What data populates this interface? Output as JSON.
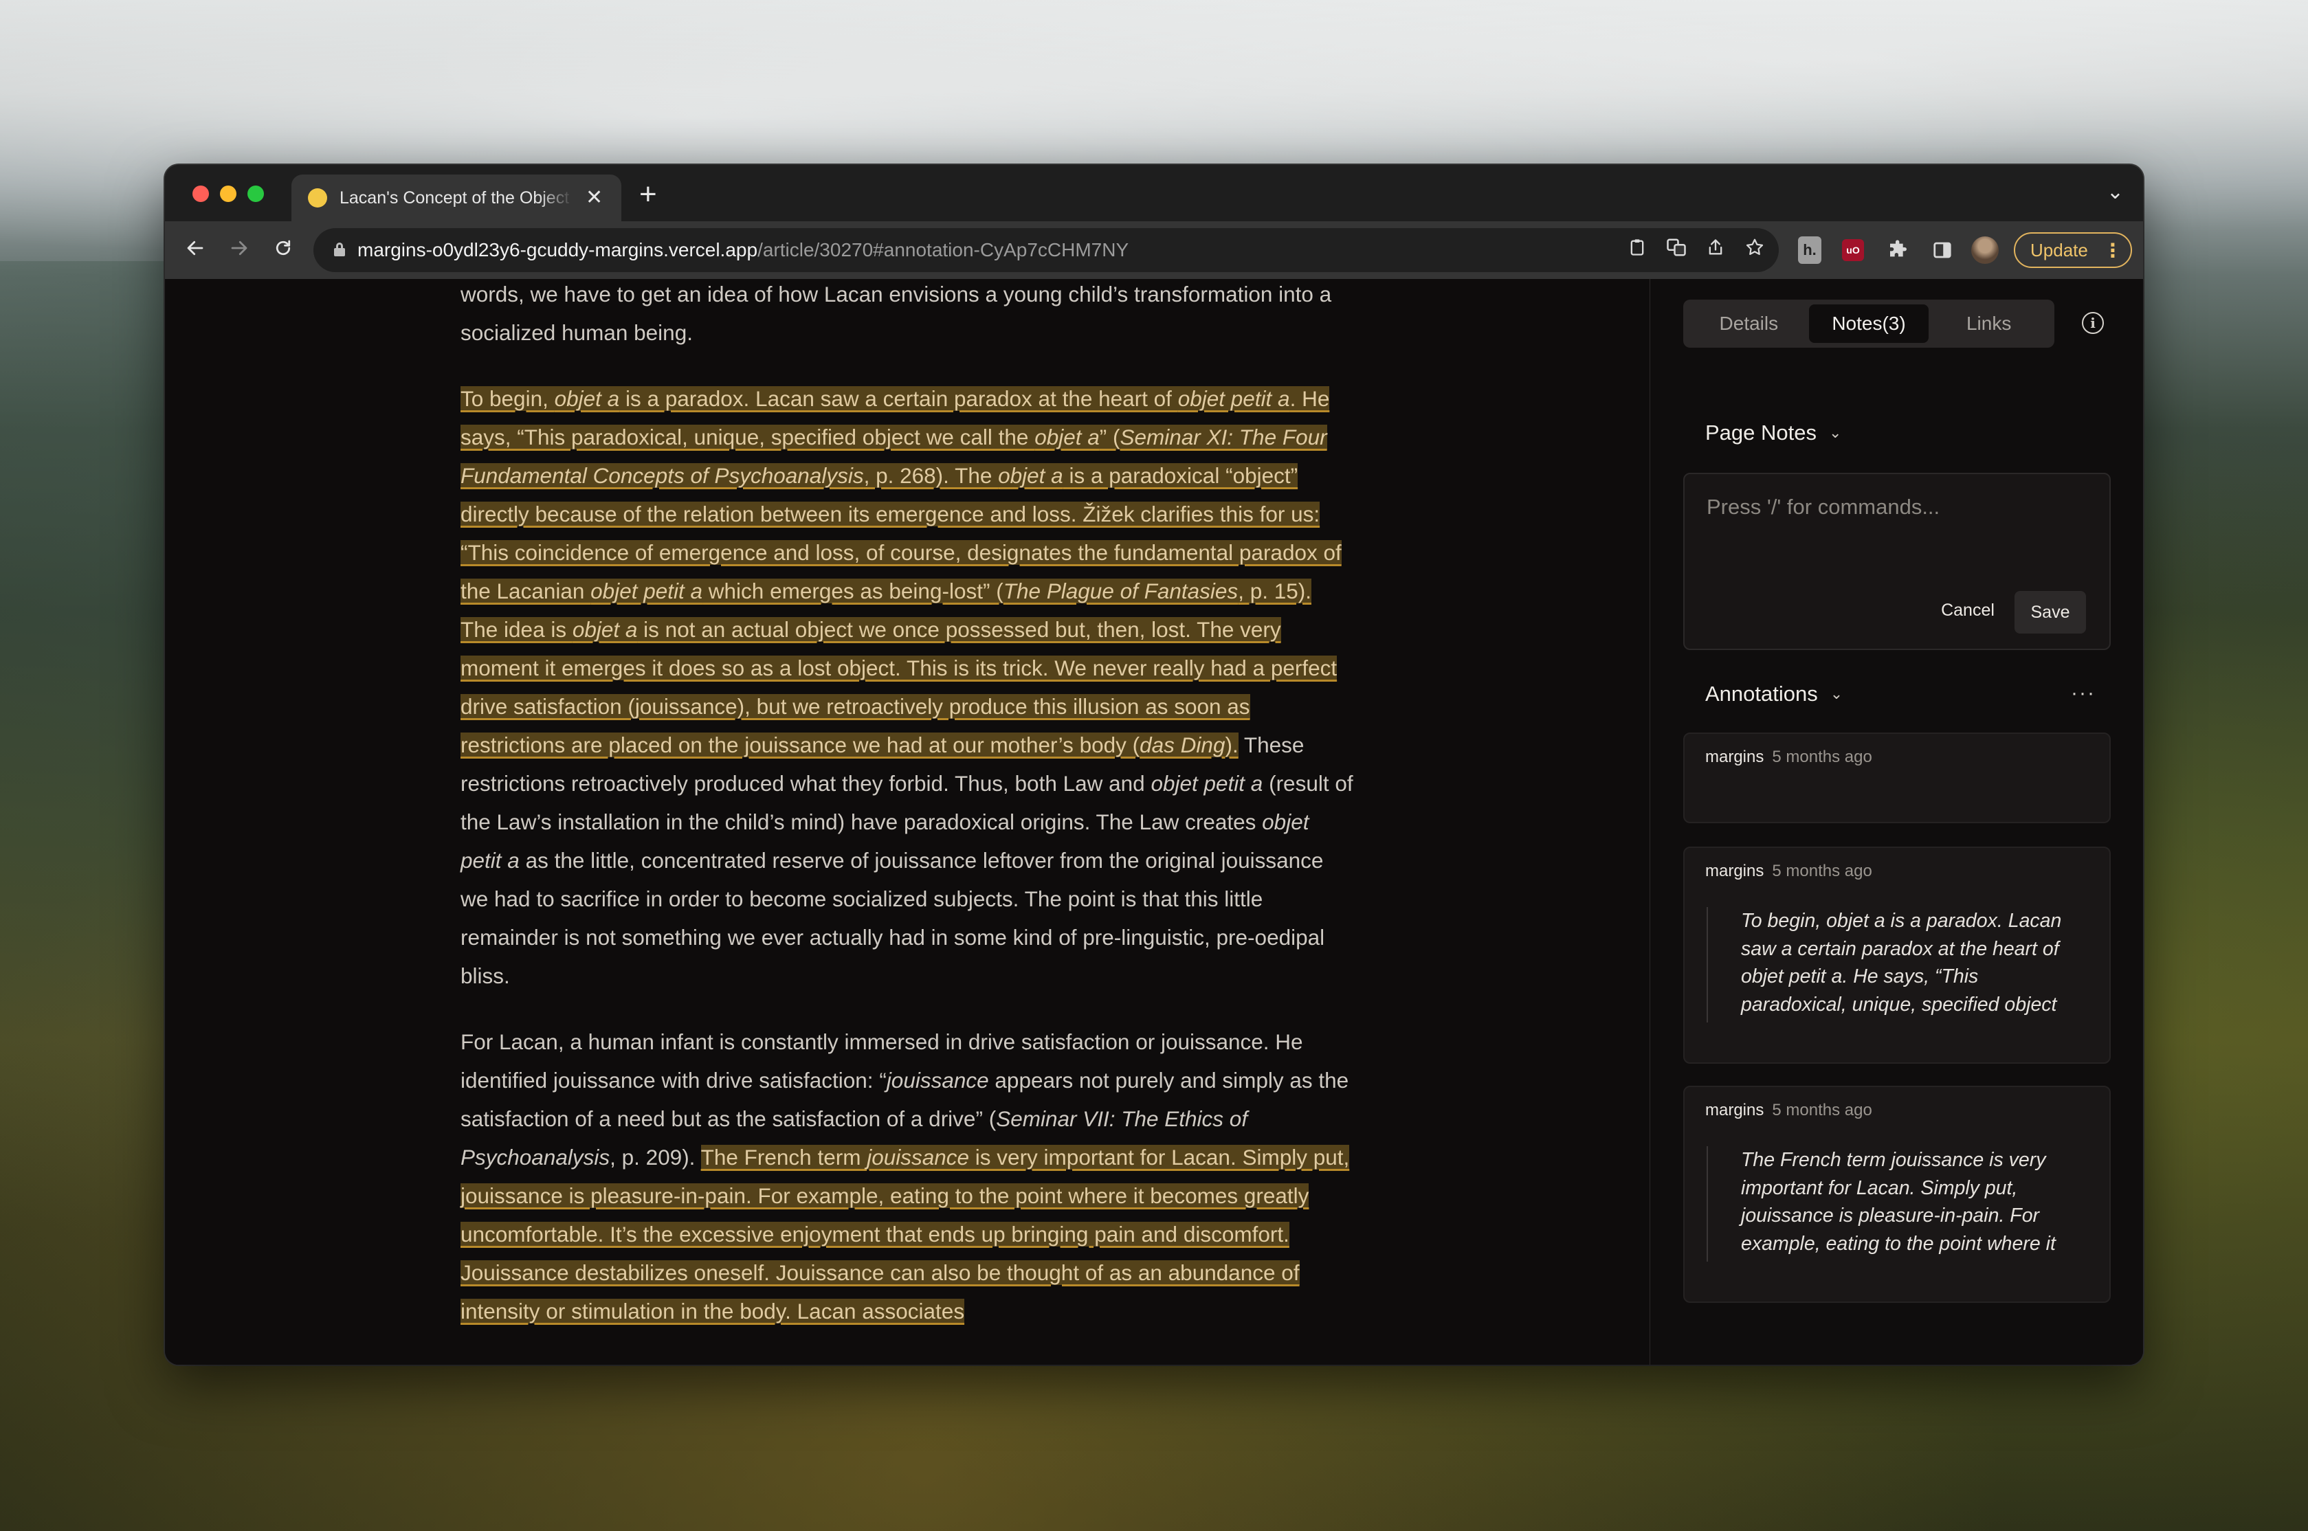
{
  "browser": {
    "tab": {
      "title": "Lacan's Concept of the Object petit a",
      "close": "✕"
    },
    "new_tab": "+",
    "tab_menu": "⌄",
    "url_host": "margins-o0ydl23y6-gcuddy-margins.vercel.app",
    "url_path": "/article/30270#annotation-CyAp7cCHM7NY",
    "update_label": "Update",
    "update_dots": "⋮",
    "ext_h": "h.",
    "ext_ub": "uO"
  },
  "article": {
    "p1": "words, we have to get an idea of how Lacan envisions a young child’s transformation into a socialized human being.",
    "p2": {
      "hl_1": "To begin, ",
      "hl_2": "objet a",
      "hl_3": " is a paradox. Lacan saw a certain paradox at the heart of ",
      "hl_4": "objet petit a",
      "hl_5": ". He says, “This paradoxical, unique, specified object we call the ",
      "hl_6": "objet a",
      "hl_7": "” (",
      "hl_8": "Seminar XI: The Four Fundamental Concepts of Psychoanalysis",
      "hl_9": ", p. 268). The ",
      "hl_10": "objet a",
      "hl_11": " is a paradoxical “object” directly because of the relation between its emergence and loss. Žižek clarifies this for us: “This coincidence of emergence and loss, of course, designates the fundamental paradox of the Lacanian ",
      "hl_12": "objet petit a",
      "hl_13": " which emerges as being-lost” (",
      "hl_14": "The Plague of Fantasies",
      "hl_15": ", p. 15). The idea is ",
      "hl_16": "objet a",
      "hl_17": " is not an actual object we once possessed but, then, lost. The very moment it emerges it does so as a lost object. This is its trick. We never really had a perfect drive satisfaction (jouissance), but we retroactively produce this illusion as soon as restrictions are placed on the jouissance we had at our mother’s body (",
      "hl_18": "das Ding",
      "hl_19": ").",
      "t_1": " These restrictions retroactively produced what they forbid. Thus, both Law and ",
      "t_2": "objet petit a",
      "t_3": " (result of the Law’s installation in the child’s mind) have paradoxical origins. The Law creates ",
      "t_4": "objet petit a",
      "t_5": " as the little, concentrated reserve of jouissance leftover from the original jouissance we had to sacrifice in order to become socialized subjects. The point is that this little remainder is not something we ever actually had in some kind of pre-linguistic, pre-oedipal bliss."
    },
    "p3": {
      "t_1": "For Lacan, a human infant is constantly immersed in drive satisfaction or jouissance. He identified jouissance with drive satisfaction: “",
      "t_2": "jouissance",
      "t_3": " appears not purely and simply as the satisfaction of a need but as the satisfaction of a drive” (",
      "t_4": "Seminar VII: The Ethics of Psychoanalysis",
      "t_5": ", p. 209). ",
      "hl_1": "The French term ",
      "hl_2": "jouissance",
      "hl_3": " is very important for Lacan. Simply put, jouissance is pleasure-in-pain. For example, eating to the point where it becomes greatly uncomfortable. It’s the excessive enjoyment that ends up bringing pain and discomfort. Jouissance destabilizes oneself. Jouissance can also be thought of as an abundance of intensity or stimulation in the body. Lacan associates"
    }
  },
  "sidebar": {
    "tabs": [
      "Details",
      "Notes(3)",
      "Links"
    ],
    "info_icon": "i",
    "page_notes": {
      "title": "Page Notes",
      "placeholder": "Press '/' for commands...",
      "cancel": "Cancel",
      "save": "Save"
    },
    "annotations": {
      "title": "Annotations",
      "more": "···",
      "items": [
        {
          "user": "margins",
          "time": "5 months ago",
          "quote": ""
        },
        {
          "user": "margins",
          "time": "5 months ago",
          "quote": "To begin, objet a is a paradox. Lacan saw a certain paradox at the heart of objet petit a. He says, “This paradoxical, unique, specified object"
        },
        {
          "user": "margins",
          "time": "5 months ago",
          "quote": "The French term jouissance is very important for Lacan. Simply put, jouissance is pleasure-in-pain. For example, eating to the point where it"
        }
      ]
    },
    "chevron": "⌄"
  }
}
